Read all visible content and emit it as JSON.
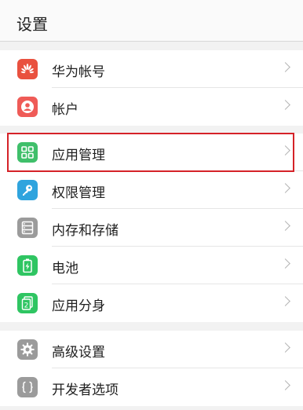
{
  "header": {
    "title": "设置"
  },
  "group1": {
    "items": [
      {
        "label": "华为帐号",
        "icon": "huawei-logo-icon",
        "color": "#e9513f"
      },
      {
        "label": "帐户",
        "icon": "user-icon",
        "color": "#ef5b57"
      }
    ]
  },
  "group2": {
    "items": [
      {
        "label": "应用管理",
        "icon": "app-grid-icon",
        "color": "#3fbf6a",
        "highlighted": true
      },
      {
        "label": "权限管理",
        "icon": "key-icon",
        "color": "#2fa4de"
      },
      {
        "label": "内存和存储",
        "icon": "storage-icon",
        "color": "#9b9b9b"
      },
      {
        "label": "电池",
        "icon": "battery-icon",
        "color": "#2fc562"
      },
      {
        "label": "应用分身",
        "icon": "app-twin-icon",
        "color": "#2fc562"
      }
    ]
  },
  "group3": {
    "items": [
      {
        "label": "高级设置",
        "icon": "gear-icon",
        "color": "#9b9b9b"
      },
      {
        "label": "开发者选项",
        "icon": "code-braces-icon",
        "color": "#9b9b9b"
      }
    ]
  },
  "highlight_color": "#d52228"
}
